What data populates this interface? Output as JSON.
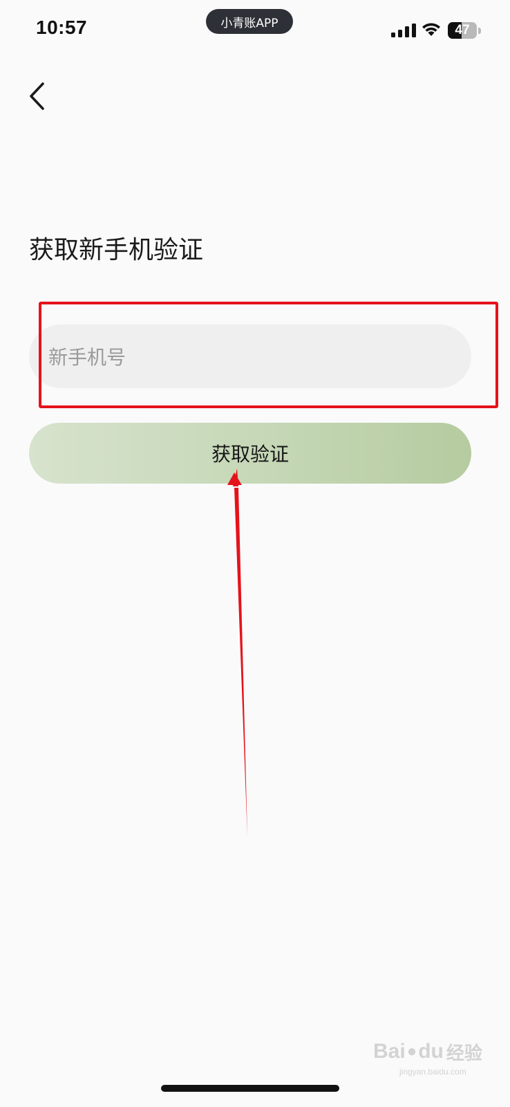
{
  "status_bar": {
    "time": "10:57",
    "app_name": "小青账APP",
    "battery_level": "47",
    "battery_fraction": 0.47
  },
  "nav": {
    "back_icon": "chevron-left-icon"
  },
  "page": {
    "title": "获取新手机验证"
  },
  "form": {
    "phone_placeholder": "新手机号",
    "phone_value": "",
    "submit_label": "获取验证"
  },
  "watermark": {
    "brand": "Bai",
    "brand_tail": "du",
    "suffix": "经验",
    "url": "jingyan.baidu.com"
  },
  "colors": {
    "annotation": "#e5131b",
    "button_gradient_start": "#d7e3cd",
    "button_gradient_end": "#b6cba0",
    "field_background": "#efefef",
    "page_background": "#fafafa"
  }
}
